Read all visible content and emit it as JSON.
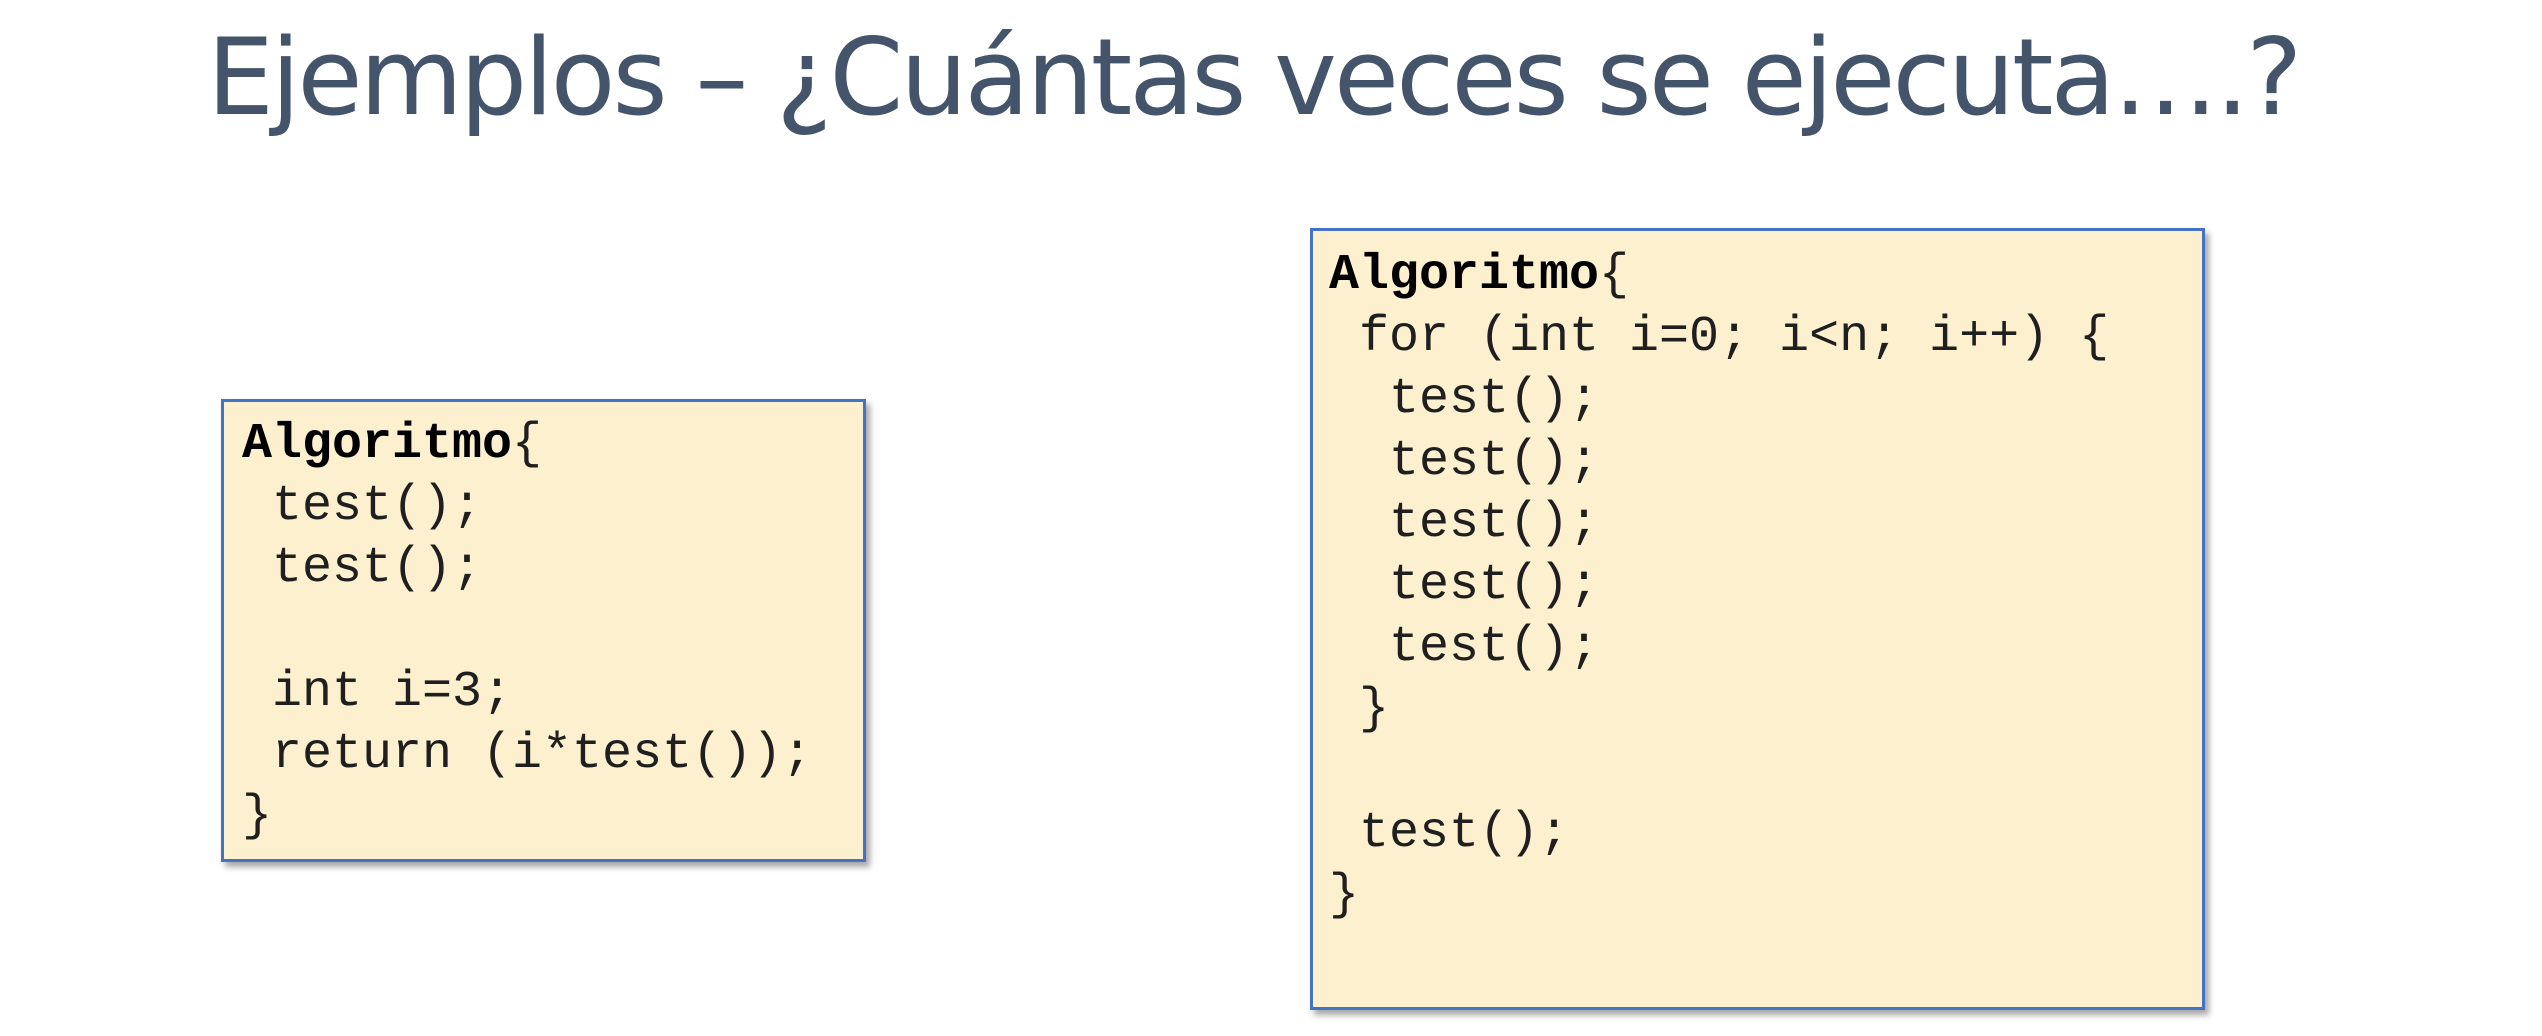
{
  "slide": {
    "title": "Ejemplos – ¿Cuántas veces se ejecuta….?"
  },
  "code_left": {
    "keyword": "Algoritmo",
    "open_brace": "{",
    "lines": [
      " test();",
      " test();",
      "",
      " int i=3;",
      " return (i*test());",
      "}"
    ]
  },
  "code_right": {
    "keyword": "Algoritmo",
    "open_brace": "{",
    "lines": [
      " for (int i=0; i<n; i++) {",
      "  test();",
      "  test();",
      "  test();",
      "  test();",
      "  test();",
      " }",
      "",
      " test();",
      "}"
    ]
  },
  "colors": {
    "title": "#44546a",
    "box_fill": "#fcf0cf",
    "box_border": "#4472c4"
  }
}
